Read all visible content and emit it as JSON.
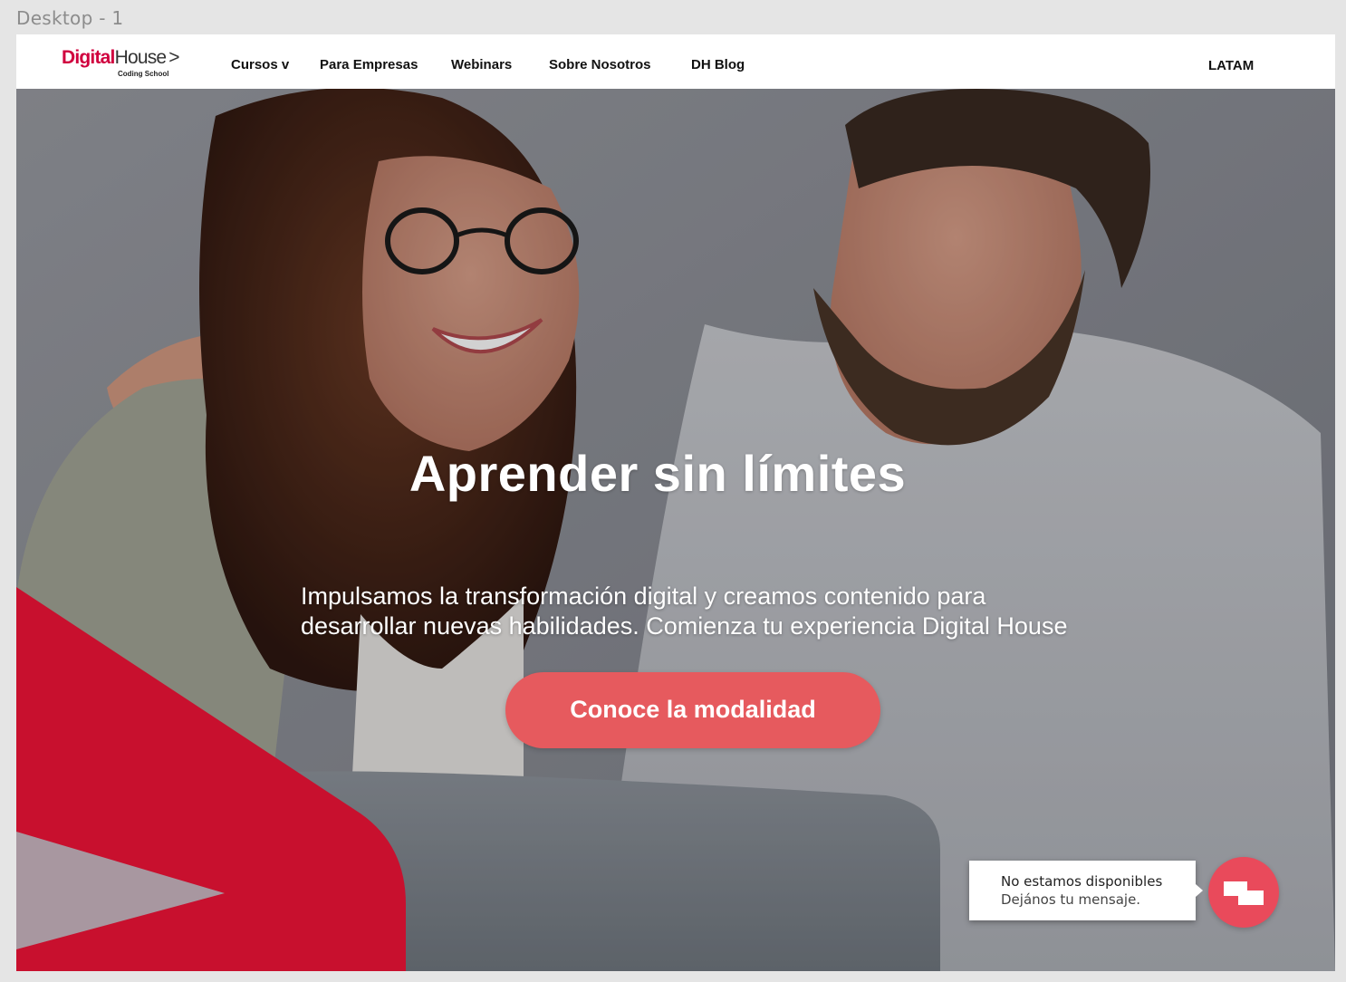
{
  "frame": {
    "label": "Desktop - 1"
  },
  "colors": {
    "brand_red": "#d0003e",
    "accent_red": "#c8102e",
    "cta": "#e65a5e",
    "chat": "#e94a5b"
  },
  "header": {
    "logo": {
      "brand_part1": "Digital",
      "brand_part2": "House",
      "arrow": ">",
      "tagline": "Coding School"
    },
    "nav": [
      {
        "label": "Cursos v"
      },
      {
        "label": "Para Empresas"
      },
      {
        "label": "Webinars"
      },
      {
        "label": "Sobre Nosotros"
      },
      {
        "label": "DH Blog"
      }
    ],
    "region": "LATAM"
  },
  "hero": {
    "title": "Aprender sin límites",
    "subtitle_line1": "Impulsamos la transformación digital y creamos contenido para",
    "subtitle_line2": "desarrollar nuevas habilidades. Comienza tu experiencia Digital House",
    "cta_label": "Conoce la modalidad"
  },
  "chat": {
    "status": "No estamos disponibles",
    "prompt": "Dejános tu mensaje.",
    "icon": "chat-icon"
  }
}
